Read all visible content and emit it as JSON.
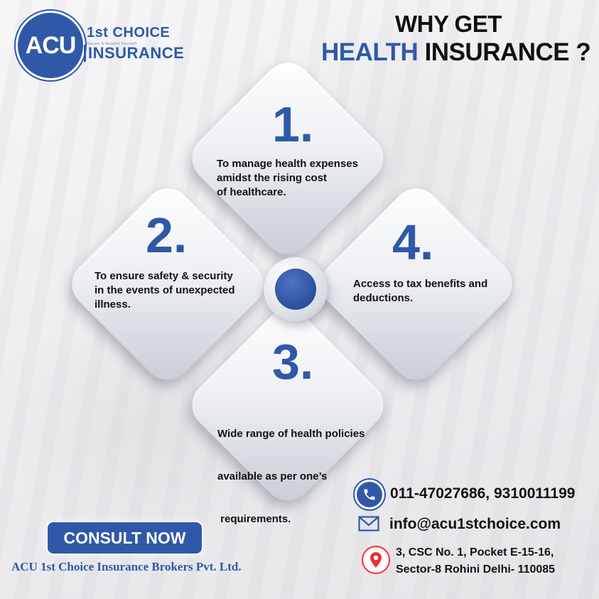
{
  "logo": {
    "mark": "ACU",
    "line1": "1st CHOICE",
    "tagline": "Secure & Reward Yourself",
    "line2": "INSURANCE"
  },
  "heading": {
    "line1": "WHY GET",
    "highlight": "HEALTH",
    "rest": "INSURANCE ?"
  },
  "reasons": [
    {
      "number": "1.",
      "lines": [
        "To manage health expenses",
        "amidst the rising cost",
        "of healthcare."
      ]
    },
    {
      "number": "2.",
      "lines": [
        "To ensure safety & security",
        "in the events of unexpected",
        "illness."
      ]
    },
    {
      "number": "3.",
      "lines": [
        "Wide range of health policies",
        "available as per one’s",
        " requirements."
      ]
    },
    {
      "number": "4.",
      "lines": [
        "Access to tax benefits and",
        "deductions."
      ]
    }
  ],
  "cta": {
    "label": "CONSULT NOW"
  },
  "company": "ACU 1st Choice Insurance Brokers Pvt. Ltd.",
  "contact": {
    "phone": "011-47027686, 9310011199",
    "email": "info@acu1stchoice.com",
    "address_line1": "3, CSC No. 1, Pocket E-15-16,",
    "address_line2": "Sector-8 Rohini Delhi- 110085"
  },
  "icons": {
    "phone": "phone-icon",
    "email": "mail-icon",
    "address": "location-pin-icon"
  },
  "colors": {
    "brand_blue": "#2f59a8",
    "text": "#111111",
    "pin_red": "#e33333"
  }
}
